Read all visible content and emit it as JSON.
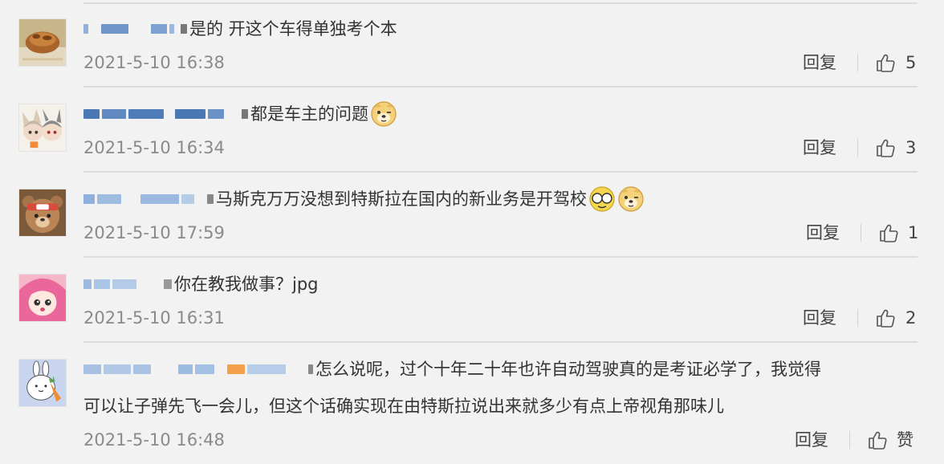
{
  "comments": [
    {
      "text": "是的 开这个车得单独考个本",
      "timestamp": "2021-5-10 16:38",
      "reply_label": "回复",
      "like_count": "5"
    },
    {
      "text": "都是车主的问题",
      "emoji": "doge-emoji",
      "timestamp": "2021-5-10 16:34",
      "reply_label": "回复",
      "like_count": "3"
    },
    {
      "text": "马斯克万万没想到特斯拉在国内的新业务是开驾校",
      "emoji": [
        "facepalm-laugh-emoji",
        "doge-emoji"
      ],
      "timestamp": "2021-5-10 17:59",
      "reply_label": "回复",
      "like_count": "1"
    },
    {
      "text": "你在教我做事？jpg",
      "timestamp": "2021-5-10 16:31",
      "reply_label": "回复",
      "like_count": "2"
    },
    {
      "text": "怎么说呢，过个十年二十年也许自动驾驶真的是考证必学了，我觉得",
      "text_line2": "可以让子弹先飞一会儿，但这个话确实现在由特斯拉说出来就多少有点上帝视角那味儿",
      "timestamp": "2021-5-10 16:48",
      "reply_label": "回复",
      "like_count": "赞"
    }
  ],
  "colors": {
    "background": "#f2f2f2",
    "text": "#333333",
    "timestamp": "#8a8a8a",
    "divider": "#dcdcdc",
    "blurred_username": "#4a78b5"
  },
  "icons": [
    "thumbs-up-icon",
    "avatar-cat-bread",
    "avatar-anime-duo",
    "avatar-teddy-bear",
    "avatar-pink-anime",
    "avatar-rabbit-carrot"
  ]
}
